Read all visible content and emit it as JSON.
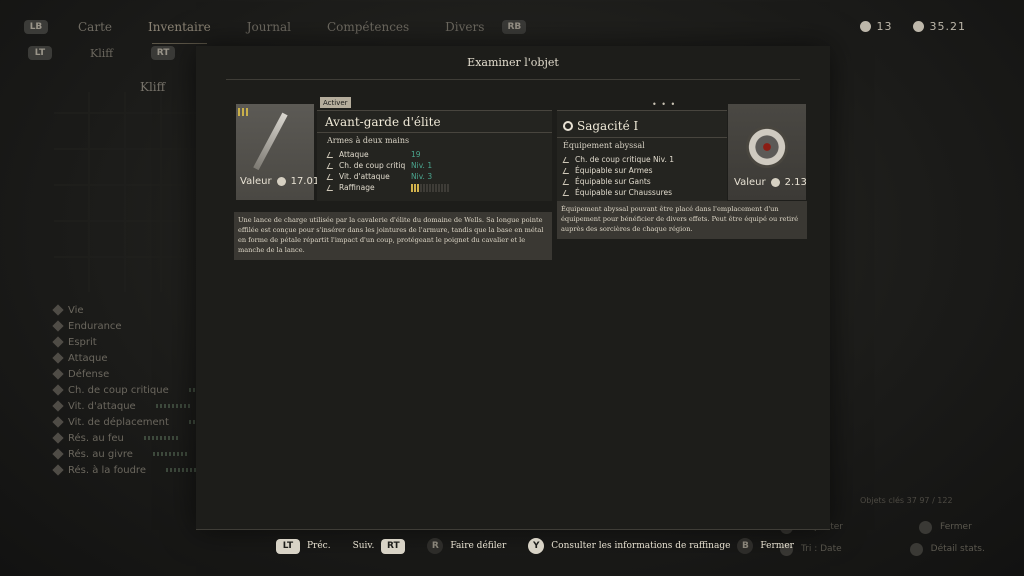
{
  "top_nav": {
    "left_btn": "LB",
    "right_btn": "RB",
    "tabs": [
      "Carte",
      "Inventaire",
      "Journal",
      "Compétences",
      "Divers"
    ],
    "active_tab": "Inventaire"
  },
  "sub_nav": {
    "left_btn": "LT",
    "label": "Kliff",
    "right_btn": "RT"
  },
  "currency": {
    "a": "13",
    "b": "35.21"
  },
  "character": {
    "name": "Kliff"
  },
  "stats_bg": [
    "Vie",
    "Endurance",
    "Esprit",
    "Attaque",
    "Défense",
    "Ch. de coup critique",
    "Vit. d'attaque",
    "Vit. de déplacement",
    "Rés. au feu",
    "Rés. au givre",
    "Rés. à la foudre"
  ],
  "bg_hints": [
    "Inspecter",
    "Fermer",
    "Tri : Date",
    "Détail stats."
  ],
  "bg_counter": "Objets clés  37   97 / 122",
  "modal": {
    "title": "Examiner l'objet",
    "left": {
      "activer": "Activer",
      "name": "Avant-garde d'élite",
      "type": "Armes à deux mains",
      "valeur_label": "Valeur",
      "valeur": "17.01",
      "stats": [
        {
          "label": "Attaque",
          "value": "19"
        },
        {
          "label": "Ch. de coup critiq",
          "value": "Niv. 1"
        },
        {
          "label": "Vit. d'attaque",
          "value": "Niv. 3"
        },
        {
          "label": "Raffinage",
          "value": ""
        }
      ],
      "refine_level": 0.23,
      "description": "Une lance de charge utilisée par la cavalerie d'élite du domaine de Wells. Sa longue pointe effilée est conçue pour s'insérer dans les jointures de l'armure, tandis que la base en métal en forme de pétale répartit l'impact d'un coup, protégeant le poignet du cavalier et le manche de la lance."
    },
    "right": {
      "name": "Sagacité I",
      "type": "Équipement abyssal",
      "valeur_label": "Valeur",
      "valeur": "2.13",
      "effects": [
        "Ch. de coup critique Niv. 1",
        "Équipable sur Armes",
        "Équipable sur Gants",
        "Équipable sur Chaussures"
      ],
      "description": "Équipement abyssal pouvant être placé dans l'emplacement d'un équipement pour bénéficier de divers effets. Peut être équipé ou retiré auprès des sorcières de chaque région."
    }
  },
  "controls": {
    "prev_btn": "LT",
    "prev": "Préc.",
    "next": "Suiv.",
    "next_btn": "RT",
    "scroll_btn": "R",
    "scroll": "Faire défiler",
    "refine_btn": "Y",
    "refine": "Consulter les informations de raffinage",
    "close_btn": "B",
    "close": "Fermer"
  }
}
